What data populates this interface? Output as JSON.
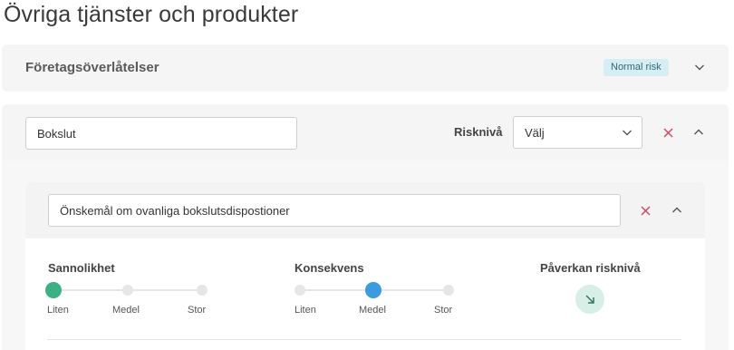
{
  "page": {
    "title": "Övriga tjänster och produkter"
  },
  "card1": {
    "title": "Företagsöverlåtelser",
    "risk_badge": "Normal risk"
  },
  "card2": {
    "name_value": "Bokslut",
    "risk_label": "Risknivå",
    "risk_select": {
      "value": "Välj"
    },
    "inner": {
      "wish_value": "Önskemål om ovanliga bokslutsdispostioner",
      "probability": {
        "label": "Sannolikhet",
        "ticks": [
          "Liten",
          "Medel",
          "Stor"
        ],
        "selected": "Liten",
        "color": "#3db082"
      },
      "consequence": {
        "label": "Konsekvens",
        "ticks": [
          "Liten",
          "Medel",
          "Stor"
        ],
        "selected": "Medel",
        "color": "#3a9be0"
      },
      "impact": {
        "label": "Påverkan risknivå",
        "icon": "arrow-down-right-icon",
        "color": "#d7efe7"
      }
    }
  },
  "colors": {
    "remove_icon": "#d64a5c",
    "badge_bg": "#d6eef3",
    "badge_text": "#2b6b7a"
  }
}
